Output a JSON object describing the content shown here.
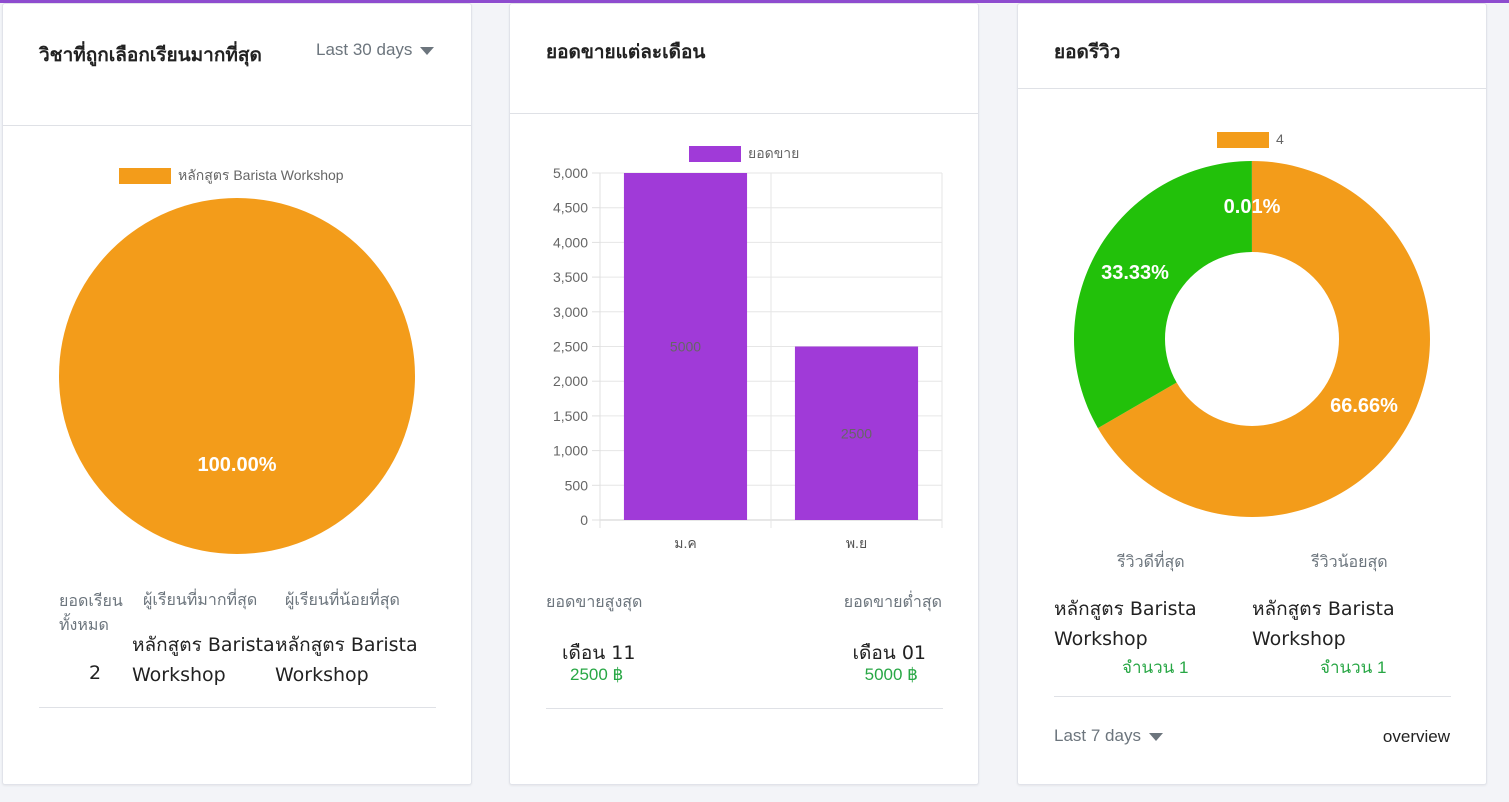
{
  "card1": {
    "title": "วิชาที่ถูกเลือกเรียนมากที่สุด",
    "period": "Last 30 days",
    "stats": {
      "total_label_line1": "ยอดเรียน",
      "total_label_line2": "ทั้งหมด",
      "total_value": "2",
      "most_label": "ผู้เรียนที่มากที่สุด",
      "most_value_line1": "หลักสูตร Barista",
      "most_value_line2": "Workshop",
      "least_label": "ผู้เรียนที่น้อยที่สุด",
      "least_value_line1": "หลักสูตร Barista",
      "least_value_line2": "Workshop"
    }
  },
  "card2": {
    "title": "ยอดขายแต่ละเดือน",
    "max_label": "ยอดขายสูงสุด",
    "max_month": "เดือน 11",
    "max_amount": "2500 ฿",
    "min_label": "ยอดขายต่ำสุด",
    "min_month": "เดือน 01",
    "min_amount": "5000 ฿"
  },
  "card3": {
    "title": "ยอดรีวิว",
    "best_label": "รีวิวดีที่สุด",
    "best_value_line1": "หลักสูตร Barista",
    "best_value_line2": "Workshop",
    "best_count": "จำนวน 1",
    "worst_label": "รีวิวน้อยสุด",
    "worst_value_line1": "หลักสูตร Barista",
    "worst_value_line2": "Workshop",
    "worst_count": "จำนวน 1",
    "period": "Last 7 days",
    "overview": "overview"
  },
  "chart_data": [
    {
      "type": "pie",
      "legend": [
        "หลักสูตร Barista Workshop"
      ],
      "legend_position": "top",
      "slices": [
        {
          "label": "หลักสูตร Barista Workshop",
          "value": 100.0,
          "display": "100.00%",
          "color": "#f39c1a"
        }
      ]
    },
    {
      "type": "bar",
      "legend": [
        "ยอดขาย"
      ],
      "legend_position": "top",
      "categories": [
        "ม.ค",
        "พ.ย"
      ],
      "series": [
        {
          "name": "ยอดขาย",
          "values": [
            5000,
            2500
          ],
          "color": "#a03ad8"
        }
      ],
      "data_labels": [
        "5000",
        "2500"
      ],
      "ylim": [
        0,
        5000
      ],
      "yticks": [
        "0",
        "500",
        "1,000",
        "1,500",
        "2,000",
        "2,500",
        "3,000",
        "3,500",
        "4,000",
        "4,500",
        "5,000"
      ],
      "grid": true
    },
    {
      "type": "pie",
      "subtype": "doughnut",
      "legend": [
        "4"
      ],
      "legend_position": "top",
      "slices": [
        {
          "value": 66.66,
          "display": "66.66%",
          "color": "#f39c1a"
        },
        {
          "value": 33.33,
          "display": "33.33%",
          "color": "#22c10a"
        },
        {
          "value": 0.01,
          "display": "0.01%",
          "color": "#8e4ccf"
        }
      ]
    }
  ]
}
